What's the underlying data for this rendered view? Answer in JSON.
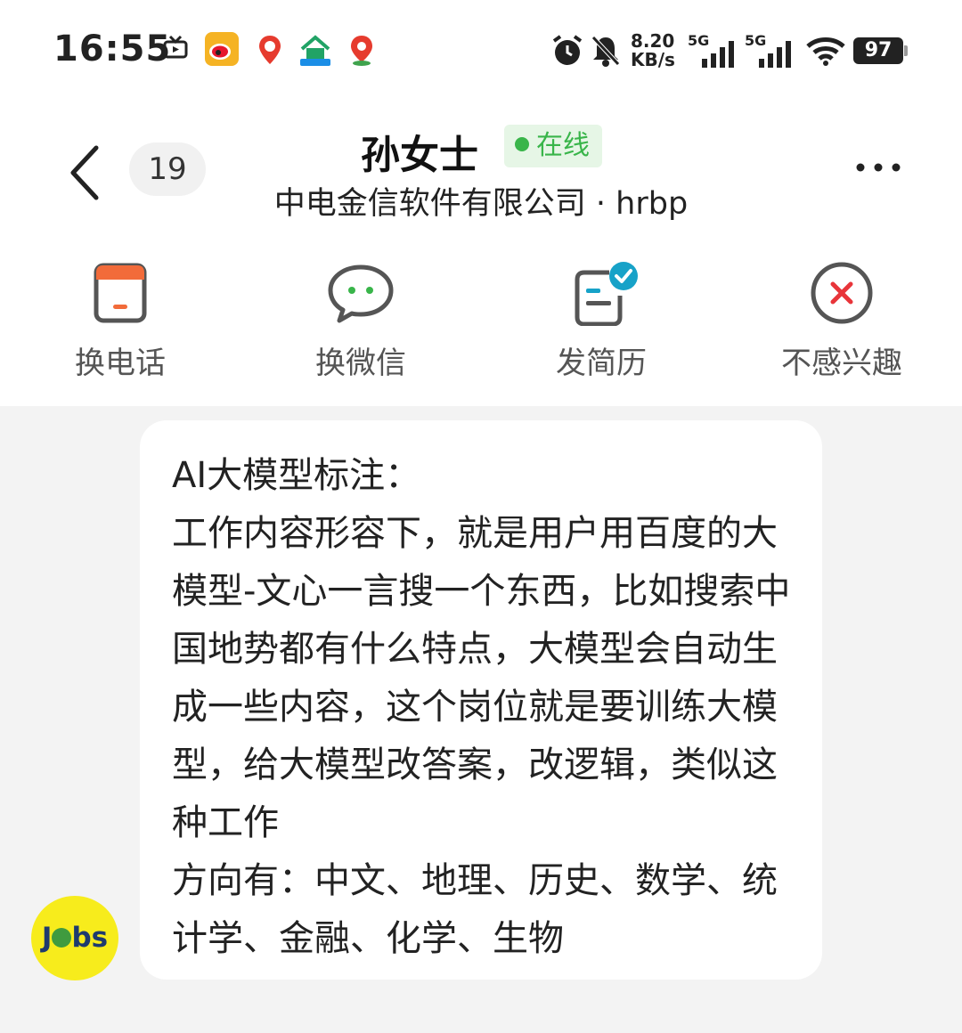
{
  "status_bar": {
    "time": "16:55",
    "net_speed_value": "8.20",
    "net_speed_unit": "KB/s",
    "sim1_label": "5G",
    "sim2_label": "5G",
    "battery": "97",
    "icons": [
      "tv-icon",
      "weibo-icon",
      "baidu-map-icon",
      "vr-house-icon",
      "baidu-location-icon",
      "alarm-icon",
      "mute-icon",
      "signal-icon",
      "wifi-icon",
      "battery-icon"
    ]
  },
  "header": {
    "badge_count": "19",
    "contact_name": "孙女士",
    "online_label": "在线",
    "company_line": "中电金信软件有限公司 · hrbp"
  },
  "actions": [
    {
      "label": "换电话",
      "icon": "phone-icon"
    },
    {
      "label": "换微信",
      "icon": "wechat-icon"
    },
    {
      "label": "发简历",
      "icon": "resume-icon"
    },
    {
      "label": "不感兴趣",
      "icon": "not-interested-icon"
    }
  ],
  "message": {
    "text": "AI大模型标注：\n工作内容形容下，就是用户用百度的大模型-文心一言搜一个东西，比如搜索中国地势都有什么特点，大模型会自动生成一些内容，这个岗位就是要训练大模型，给大模型改答案，改逻辑，类似这种工作\n方向有：中文、地理、历史、数学、统计学、金融、化学、生物"
  },
  "avatar_text": {
    "left": "J",
    "right": "bs"
  },
  "colors": {
    "online_green": "#39b54a",
    "phone_orange": "#f26b3a",
    "check_teal": "#17a2c8",
    "close_red": "#e8353a",
    "jobs_yellow": "#f7ec1c"
  }
}
